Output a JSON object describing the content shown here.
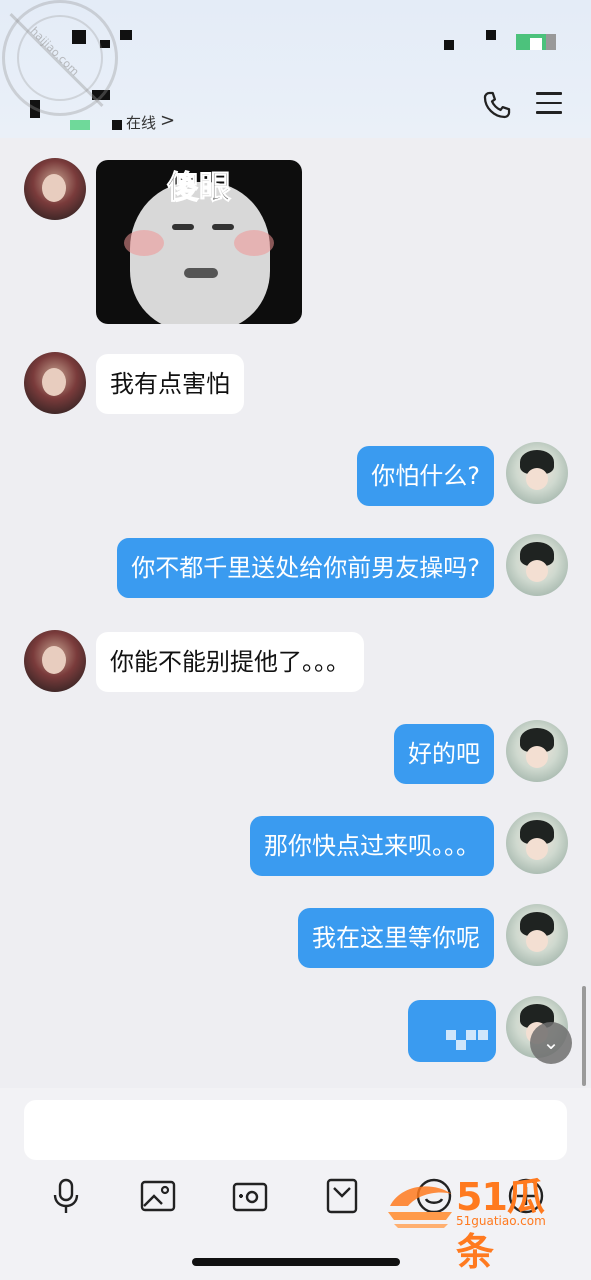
{
  "header": {
    "status_text": "在线",
    "status_arrow": ">",
    "watermark": "haijiao.com"
  },
  "messages": [
    {
      "sender": "other",
      "type": "sticker",
      "caption": "傻眼"
    },
    {
      "sender": "other",
      "type": "text",
      "text": "我有点害怕"
    },
    {
      "sender": "me",
      "type": "text",
      "text": "你怕什么?"
    },
    {
      "sender": "me",
      "type": "text",
      "text": "你不都千里送处给你前男友操吗?"
    },
    {
      "sender": "other",
      "type": "text",
      "text": "你能不能别提他了。。。"
    },
    {
      "sender": "me",
      "type": "text",
      "text": "好的吧"
    },
    {
      "sender": "me",
      "type": "text",
      "text": "那你快点过来呗。。。"
    },
    {
      "sender": "me",
      "type": "text",
      "text": "我在这里等你呢"
    },
    {
      "sender": "me",
      "type": "pixelated"
    }
  ],
  "composer": {
    "input_value": "",
    "tools": [
      "microphone-icon",
      "image-icon",
      "camera-icon",
      "mailbox-icon",
      "emoji-icon",
      "plus-icon"
    ]
  },
  "overlay_logo": {
    "text": "51瓜条",
    "url": "51guatiao.com"
  },
  "colors": {
    "outgoing_bubble": "#3a9bf0",
    "incoming_bubble": "#ffffff",
    "background": "#eeeef2",
    "logo": "#ff7a1f"
  }
}
